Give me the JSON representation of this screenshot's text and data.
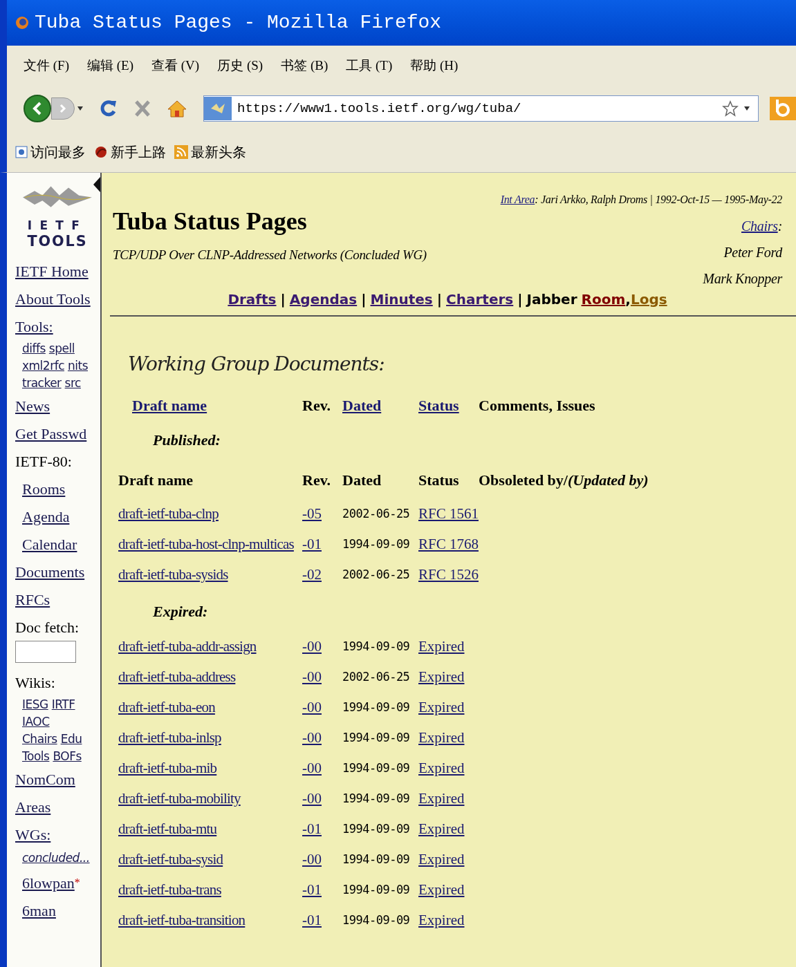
{
  "window": {
    "title": "Tuba Status Pages - Mozilla Firefox"
  },
  "menu": [
    "文件 (F)",
    "编辑 (E)",
    "查看 (V)",
    "历史 (S)",
    "书签 (B)",
    "工具 (T)",
    "帮助 (H)"
  ],
  "toolbar": {
    "url": "https://www1.tools.ietf.org/wg/tuba/"
  },
  "bookmarks": [
    {
      "kind": "page",
      "label": "访问最多"
    },
    {
      "kind": "guide",
      "label": "新手上路"
    },
    {
      "kind": "feed",
      "label": "最新头条"
    }
  ],
  "logo": {
    "lines": [
      "IETF",
      "TOOLS"
    ]
  },
  "sidebar": {
    "items": [
      {
        "kind": "link",
        "text": "IETF Home"
      },
      {
        "kind": "link",
        "text": "About Tools"
      },
      {
        "kind": "link",
        "text": "Tools:",
        "children": [
          {
            "kind": "row",
            "links": [
              "diffs",
              "spell"
            ]
          },
          {
            "kind": "row",
            "links": [
              "xml2rfc",
              "nits"
            ]
          },
          {
            "kind": "row",
            "links": [
              "tracker",
              "src"
            ]
          }
        ]
      },
      {
        "kind": "link",
        "text": "News"
      },
      {
        "kind": "link",
        "text": "Get Passwd"
      },
      {
        "kind": "text",
        "text": "IETF-80:",
        "children": [
          {
            "kind": "link",
            "text": "Rooms"
          },
          {
            "kind": "link",
            "text": "Agenda"
          },
          {
            "kind": "link",
            "text": "Calendar"
          }
        ]
      },
      {
        "kind": "link",
        "text": "Documents"
      },
      {
        "kind": "link",
        "text": "RFCs"
      },
      {
        "kind": "text",
        "text": "Doc fetch:"
      },
      {
        "kind": "field"
      },
      {
        "kind": "text",
        "text": "Wikis:",
        "children": [
          {
            "kind": "row",
            "links": [
              "IESG",
              "IRTF"
            ]
          },
          {
            "kind": "row",
            "links": [
              "IAOC"
            ]
          },
          {
            "kind": "row",
            "links": [
              "Chairs",
              "Edu"
            ]
          },
          {
            "kind": "row",
            "links": [
              "Tools",
              "BOFs"
            ]
          }
        ]
      },
      {
        "kind": "link",
        "text": "NomCom"
      },
      {
        "kind": "link",
        "text": "Areas"
      },
      {
        "kind": "link",
        "text": "WGs:",
        "children": [
          {
            "kind": "more",
            "text": "concluded..."
          },
          {
            "kind": "link",
            "text": "6lowpan",
            "marker": "*"
          },
          {
            "kind": "link",
            "text": "6man"
          }
        ]
      }
    ]
  },
  "header": {
    "title": "Tuba Status Pages",
    "subtitle": "TCP/UDP Over CLNP-Addressed Networks (Concluded WG)",
    "area_link": "Int Area",
    "area_info": ": Jari Arkko, Ralph Droms | 1992-Oct-15 — 1995-May-22",
    "chairs_link": "Chairs",
    "chairs_colon": ":",
    "chairs": [
      "Peter Ford",
      "Mark Knopper"
    ]
  },
  "nav": [
    {
      "kind": "link",
      "text": "Drafts"
    },
    {
      "kind": "sep",
      "text": "|"
    },
    {
      "kind": "link",
      "text": "Agendas"
    },
    {
      "kind": "sep",
      "text": "|"
    },
    {
      "kind": "link",
      "text": "Minutes"
    },
    {
      "kind": "sep",
      "text": "|"
    },
    {
      "kind": "link",
      "text": "Charters"
    },
    {
      "kind": "sep",
      "text": "|"
    },
    {
      "kind": "text",
      "text": "Jabber"
    },
    {
      "kind": "link",
      "text": "Room",
      "color": "#800000"
    },
    {
      "kind": "text",
      "text": ","
    },
    {
      "kind": "link",
      "text": "Logs",
      "color": "#8b5a00"
    }
  ],
  "documents": {
    "heading": "Working Group Documents:",
    "columns": [
      {
        "text": "Draft name",
        "link": true
      },
      {
        "text": "Rev.",
        "link": false
      },
      {
        "text": "Dated",
        "link": true
      },
      {
        "text": "Status",
        "link": true
      },
      {
        "text": "Comments, Issues",
        "link": false
      }
    ],
    "groups": [
      {
        "title": "Published:",
        "columns": [
          "Draft name",
          "Rev.",
          "Dated",
          "Status",
          "Obsoleted by/*(Updated by)*"
        ],
        "rows": [
          {
            "name": "draft-ietf-tuba-clnp",
            "rev": "-05",
            "dated": "2002-06-25",
            "status": "RFC 1561"
          },
          {
            "name": "draft-ietf-tuba-host-clnp-multicas",
            "rev": "-01",
            "dated": "1994-09-09",
            "status": "RFC 1768"
          },
          {
            "name": "draft-ietf-tuba-sysids",
            "rev": "-02",
            "dated": "2002-06-25",
            "status": "RFC 1526"
          }
        ]
      },
      {
        "title": "Expired:",
        "rows": [
          {
            "name": "draft-ietf-tuba-addr-assign",
            "rev": "-00",
            "dated": "1994-09-09",
            "status": "Expired"
          },
          {
            "name": "draft-ietf-tuba-address",
            "rev": "-00",
            "dated": "2002-06-25",
            "status": "Expired"
          },
          {
            "name": "draft-ietf-tuba-eon",
            "rev": "-00",
            "dated": "1994-09-09",
            "status": "Expired"
          },
          {
            "name": "draft-ietf-tuba-inlsp",
            "rev": "-00",
            "dated": "1994-09-09",
            "status": "Expired"
          },
          {
            "name": "draft-ietf-tuba-mib",
            "rev": "-00",
            "dated": "1994-09-09",
            "status": "Expired"
          },
          {
            "name": "draft-ietf-tuba-mobility",
            "rev": "-00",
            "dated": "1994-09-09",
            "status": "Expired"
          },
          {
            "name": "draft-ietf-tuba-mtu",
            "rev": "-01",
            "dated": "1994-09-09",
            "status": "Expired"
          },
          {
            "name": "draft-ietf-tuba-sysid",
            "rev": "-00",
            "dated": "1994-09-09",
            "status": "Expired"
          },
          {
            "name": "draft-ietf-tuba-trans",
            "rev": "-01",
            "dated": "1994-09-09",
            "status": "Expired"
          },
          {
            "name": "draft-ietf-tuba-transition",
            "rev": "-01",
            "dated": "1994-09-09",
            "status": "Expired"
          }
        ]
      }
    ]
  }
}
